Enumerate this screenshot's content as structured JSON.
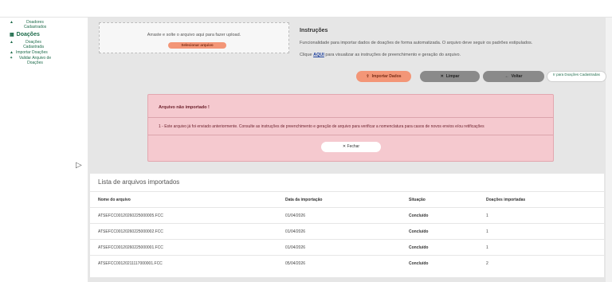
{
  "sidebar": {
    "items_top": [
      {
        "label": "Doadores Cadastrados",
        "icon": "home-icon"
      }
    ],
    "section": {
      "label": "Doações",
      "icon": "grid-icon"
    },
    "items": [
      {
        "label": "Doações Cadastrada",
        "icon": "home-icon"
      },
      {
        "label": "Importar Doações",
        "icon": "home-icon"
      },
      {
        "label": "Validar Arquivo de Doações",
        "icon": "pin-icon"
      }
    ]
  },
  "upload": {
    "drop_text": "Arraste e solte o arquivo aqui para fazer upload.",
    "select_label": "Selecionar arquivo"
  },
  "instructions": {
    "title": "Instruções",
    "line1": "Funcionalidade para importar dados de doações de forma automatizada. O arquivo deve seguir os padrões estipulados.",
    "line2_pre": "Clique",
    "line2_link": "AQUI",
    "line2_post": "para visualizar as instruções de preenchimento e geração do arquivo."
  },
  "actions": {
    "import_label": "Importar Dados",
    "clear_label": "Limpar",
    "back_label": "Voltar",
    "goto_label": "Ir para Doações Cadastradas"
  },
  "alert": {
    "title": "Arquivo não importado !",
    "message": "1 - Este arquivo já foi enviado anteriormente. Consulte as instruções de preenchimento e geração de arquivo para verificar a nomenclatura para casos de novos envios e/ou retificações",
    "close_label": "Fechar"
  },
  "table": {
    "title": "Lista de arquivos importados",
    "headers": [
      "Nome do arquivo",
      "Data da importação",
      "Situação",
      "Doações importadas"
    ],
    "rows": [
      [
        "ATSEFCC00120260225000005.FCC",
        "01/04/2026",
        "Concluído",
        "1"
      ],
      [
        "ATSEFCC00120260225000002.FCC",
        "01/04/2026",
        "Concluído",
        "1"
      ],
      [
        "ATSEFCC00120260225000001.FCC",
        "01/04/2026",
        "Concluído",
        "1"
      ],
      [
        "ATSEFCC00120211117000001.FCC",
        "05/04/2026",
        "Concluído",
        "2"
      ]
    ]
  },
  "colors": {
    "brand_green": "#1d6b4a",
    "accent_orange": "#f39677",
    "alert_pink": "#f5c9cf"
  }
}
